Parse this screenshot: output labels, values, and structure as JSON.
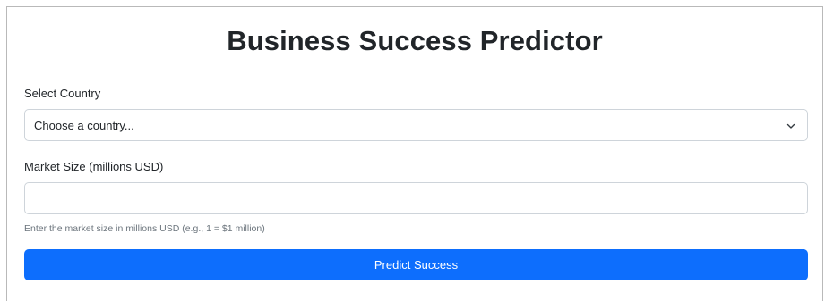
{
  "page": {
    "title": "Business Success Predictor"
  },
  "form": {
    "country": {
      "label": "Select Country",
      "selected_value": "Choose a country...",
      "icon": "chevron-down-icon"
    },
    "market_size": {
      "label": "Market Size (millions USD)",
      "value": "",
      "placeholder": "",
      "help_text": "Enter the market size in millions USD (e.g., 1 = $1 million)"
    },
    "submit": {
      "label": "Predict Success"
    }
  },
  "colors": {
    "primary": "#0d6efd",
    "border": "#ced4da",
    "muted_text": "#6c757d",
    "text": "#212529"
  }
}
